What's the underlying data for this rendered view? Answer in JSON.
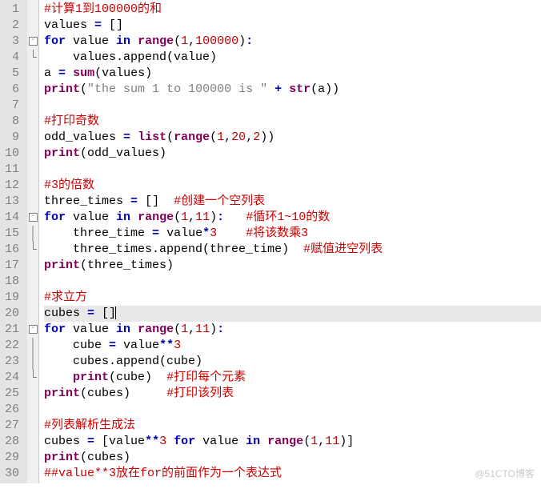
{
  "lines": [
    {
      "n": 1,
      "fold": "",
      "cur": false,
      "tokens": [
        [
          "cm",
          "#计算1到100000的和"
        ]
      ]
    },
    {
      "n": 2,
      "fold": "",
      "cur": false,
      "tokens": [
        [
          "nm",
          "values "
        ],
        [
          "op",
          "="
        ],
        [
          "nm",
          " []"
        ]
      ]
    },
    {
      "n": 3,
      "fold": "box",
      "cur": false,
      "tokens": [
        [
          "kw",
          "for"
        ],
        [
          "nm",
          " value "
        ],
        [
          "kw",
          "in"
        ],
        [
          "nm",
          " "
        ],
        [
          "bi",
          "range"
        ],
        [
          "nm",
          "("
        ],
        [
          "num",
          "1"
        ],
        [
          "nm",
          ","
        ],
        [
          "num",
          "100000"
        ],
        [
          "nm",
          ")"
        ],
        [
          "op",
          ":"
        ]
      ]
    },
    {
      "n": 4,
      "fold": "end",
      "cur": false,
      "tokens": [
        [
          "nm",
          "    values.append(value)"
        ]
      ]
    },
    {
      "n": 5,
      "fold": "",
      "cur": false,
      "tokens": [
        [
          "nm",
          "a "
        ],
        [
          "op",
          "="
        ],
        [
          "nm",
          " "
        ],
        [
          "bi",
          "sum"
        ],
        [
          "nm",
          "(values)"
        ]
      ]
    },
    {
      "n": 6,
      "fold": "",
      "cur": false,
      "tokens": [
        [
          "bi",
          "print"
        ],
        [
          "nm",
          "("
        ],
        [
          "str",
          "\"the sum 1 to 100000 is \""
        ],
        [
          "nm",
          " "
        ],
        [
          "op",
          "+"
        ],
        [
          "nm",
          " "
        ],
        [
          "bi",
          "str"
        ],
        [
          "nm",
          "(a))"
        ]
      ]
    },
    {
      "n": 7,
      "fold": "",
      "cur": false,
      "tokens": [
        [
          "nm",
          ""
        ]
      ]
    },
    {
      "n": 8,
      "fold": "",
      "cur": false,
      "tokens": [
        [
          "cm",
          "#打印奇数"
        ]
      ]
    },
    {
      "n": 9,
      "fold": "",
      "cur": false,
      "tokens": [
        [
          "nm",
          "odd_values "
        ],
        [
          "op",
          "="
        ],
        [
          "nm",
          " "
        ],
        [
          "bi",
          "list"
        ],
        [
          "nm",
          "("
        ],
        [
          "bi",
          "range"
        ],
        [
          "nm",
          "("
        ],
        [
          "num",
          "1"
        ],
        [
          "nm",
          ","
        ],
        [
          "num",
          "20"
        ],
        [
          "nm",
          ","
        ],
        [
          "num",
          "2"
        ],
        [
          "nm",
          "))"
        ]
      ]
    },
    {
      "n": 10,
      "fold": "",
      "cur": false,
      "tokens": [
        [
          "bi",
          "print"
        ],
        [
          "nm",
          "(odd_values)"
        ]
      ]
    },
    {
      "n": 11,
      "fold": "",
      "cur": false,
      "tokens": [
        [
          "nm",
          ""
        ]
      ]
    },
    {
      "n": 12,
      "fold": "",
      "cur": false,
      "tokens": [
        [
          "cm",
          "#3的倍数"
        ]
      ]
    },
    {
      "n": 13,
      "fold": "",
      "cur": false,
      "tokens": [
        [
          "nm",
          "three_times "
        ],
        [
          "op",
          "="
        ],
        [
          "nm",
          " []  "
        ],
        [
          "cm",
          "#创建一个空列表"
        ]
      ]
    },
    {
      "n": 14,
      "fold": "box",
      "cur": false,
      "tokens": [
        [
          "kw",
          "for"
        ],
        [
          "nm",
          " value "
        ],
        [
          "kw",
          "in"
        ],
        [
          "nm",
          " "
        ],
        [
          "bi",
          "range"
        ],
        [
          "nm",
          "("
        ],
        [
          "num",
          "1"
        ],
        [
          "nm",
          ","
        ],
        [
          "num",
          "11"
        ],
        [
          "nm",
          ")"
        ],
        [
          "op",
          ":"
        ],
        [
          "nm",
          "   "
        ],
        [
          "cm",
          "#循环1~10的数"
        ]
      ]
    },
    {
      "n": 15,
      "fold": "bar",
      "cur": false,
      "tokens": [
        [
          "nm",
          "    three_time "
        ],
        [
          "op",
          "="
        ],
        [
          "nm",
          " value"
        ],
        [
          "op",
          "*"
        ],
        [
          "num",
          "3"
        ],
        [
          "nm",
          "    "
        ],
        [
          "cm",
          "#将该数乘3"
        ]
      ]
    },
    {
      "n": 16,
      "fold": "end",
      "cur": false,
      "tokens": [
        [
          "nm",
          "    three_times.append(three_time)  "
        ],
        [
          "cm",
          "#赋值进空列表"
        ]
      ]
    },
    {
      "n": 17,
      "fold": "",
      "cur": false,
      "tokens": [
        [
          "bi",
          "print"
        ],
        [
          "nm",
          "(three_times)"
        ]
      ]
    },
    {
      "n": 18,
      "fold": "",
      "cur": false,
      "tokens": [
        [
          "nm",
          ""
        ]
      ]
    },
    {
      "n": 19,
      "fold": "",
      "cur": false,
      "tokens": [
        [
          "cm",
          "#求立方"
        ]
      ]
    },
    {
      "n": 20,
      "fold": "",
      "cur": true,
      "tokens": [
        [
          "nm",
          "cubes "
        ],
        [
          "op",
          "="
        ],
        [
          "nm",
          " []"
        ],
        [
          "caret",
          ""
        ]
      ]
    },
    {
      "n": 21,
      "fold": "box",
      "cur": false,
      "tokens": [
        [
          "kw",
          "for"
        ],
        [
          "nm",
          " value "
        ],
        [
          "kw",
          "in"
        ],
        [
          "nm",
          " "
        ],
        [
          "bi",
          "range"
        ],
        [
          "nm",
          "("
        ],
        [
          "num",
          "1"
        ],
        [
          "nm",
          ","
        ],
        [
          "num",
          "11"
        ],
        [
          "nm",
          ")"
        ],
        [
          "op",
          ":"
        ]
      ]
    },
    {
      "n": 22,
      "fold": "bar",
      "cur": false,
      "tokens": [
        [
          "nm",
          "    cube "
        ],
        [
          "op",
          "="
        ],
        [
          "nm",
          " value"
        ],
        [
          "op",
          "**"
        ],
        [
          "num",
          "3"
        ]
      ]
    },
    {
      "n": 23,
      "fold": "bar",
      "cur": false,
      "tokens": [
        [
          "nm",
          "    cubes.append(cube)"
        ]
      ]
    },
    {
      "n": 24,
      "fold": "end",
      "cur": false,
      "tokens": [
        [
          "nm",
          "    "
        ],
        [
          "bi",
          "print"
        ],
        [
          "nm",
          "(cube)  "
        ],
        [
          "cm",
          "#打印每个元素"
        ]
      ]
    },
    {
      "n": 25,
      "fold": "",
      "cur": false,
      "tokens": [
        [
          "bi",
          "print"
        ],
        [
          "nm",
          "(cubes)     "
        ],
        [
          "cm",
          "#打印该列表"
        ]
      ]
    },
    {
      "n": 26,
      "fold": "",
      "cur": false,
      "tokens": [
        [
          "nm",
          ""
        ]
      ]
    },
    {
      "n": 27,
      "fold": "",
      "cur": false,
      "tokens": [
        [
          "cm",
          "#列表解析生成法"
        ]
      ]
    },
    {
      "n": 28,
      "fold": "",
      "cur": false,
      "tokens": [
        [
          "nm",
          "cubes "
        ],
        [
          "op",
          "="
        ],
        [
          "nm",
          " [value"
        ],
        [
          "op",
          "**"
        ],
        [
          "num",
          "3"
        ],
        [
          "nm",
          " "
        ],
        [
          "kw",
          "for"
        ],
        [
          "nm",
          " value "
        ],
        [
          "kw",
          "in"
        ],
        [
          "nm",
          " "
        ],
        [
          "bi",
          "range"
        ],
        [
          "nm",
          "("
        ],
        [
          "num",
          "1"
        ],
        [
          "nm",
          ","
        ],
        [
          "num",
          "11"
        ],
        [
          "nm",
          ")]"
        ]
      ]
    },
    {
      "n": 29,
      "fold": "",
      "cur": false,
      "tokens": [
        [
          "bi",
          "print"
        ],
        [
          "nm",
          "(cubes)"
        ]
      ]
    },
    {
      "n": 30,
      "fold": "",
      "cur": false,
      "tokens": [
        [
          "cm",
          "##value**3放在for的前面作为一个表达式"
        ]
      ]
    }
  ],
  "watermark": "@51CTO博客"
}
